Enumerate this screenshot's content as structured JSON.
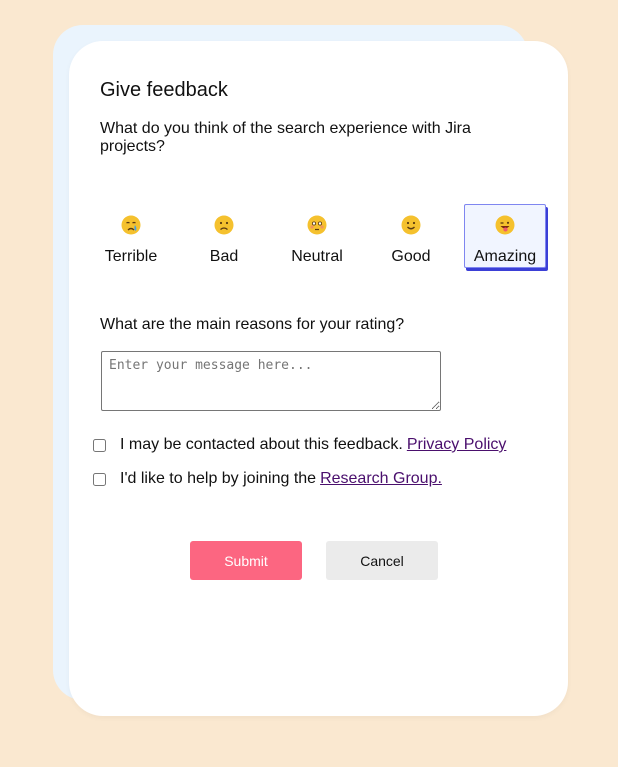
{
  "dialog": {
    "title": "Give feedback",
    "question": "What do you think of the search experience with Jira projects?"
  },
  "ratings": [
    {
      "label": "Terrible",
      "icon": "crying-face-icon",
      "selected": false
    },
    {
      "label": "Bad",
      "icon": "frowning-face-icon",
      "selected": false
    },
    {
      "label": "Neutral",
      "icon": "flushed-face-icon",
      "selected": false
    },
    {
      "label": "Good",
      "icon": "smiling-face-icon",
      "selected": false
    },
    {
      "label": "Amazing",
      "icon": "winking-tongue-face-icon",
      "selected": true
    }
  ],
  "reasons": {
    "label": "What are the main reasons for your rating?",
    "placeholder": "Enter your message here...",
    "value": ""
  },
  "consent": {
    "contact_text": "I may be contacted about this feedback.",
    "privacy_link": "Privacy Policy",
    "contact_checked": false,
    "research_text": "I'd like to help by joining the",
    "research_link": "Research Group.",
    "research_checked": false
  },
  "actions": {
    "submit_label": "Submit",
    "cancel_label": "Cancel"
  },
  "colors": {
    "page_background": "#fae8d0",
    "card_back": "#eaf4fd",
    "submit": "#fc6681",
    "cancel": "#ebebeb",
    "selected_border": "#3b3fd6",
    "link": "#4a0f6d"
  }
}
